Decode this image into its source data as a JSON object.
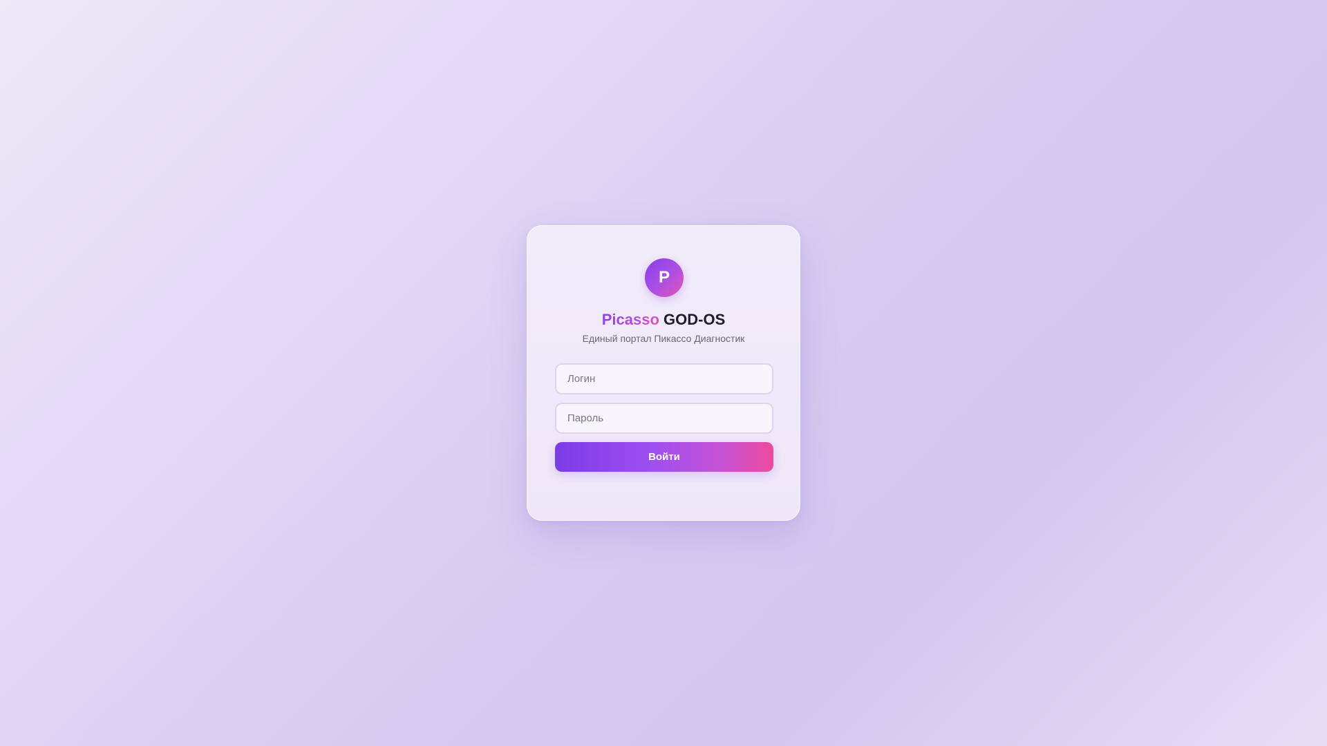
{
  "app": {
    "logo_letter": "P",
    "title_brand": "Picasso",
    "title_product": "GOD-OS",
    "subtitle": "Единый портал Пикассо Диагностик"
  },
  "form": {
    "login_placeholder": "Логин",
    "login_value": "",
    "password_placeholder": "Пароль",
    "password_value": "",
    "submit_label": "Войти"
  },
  "colors": {
    "accent_start": "#7a3ce6",
    "accent_mid": "#a04ff0",
    "accent_end": "#ec4a9e",
    "background": "#d8ccf1"
  }
}
